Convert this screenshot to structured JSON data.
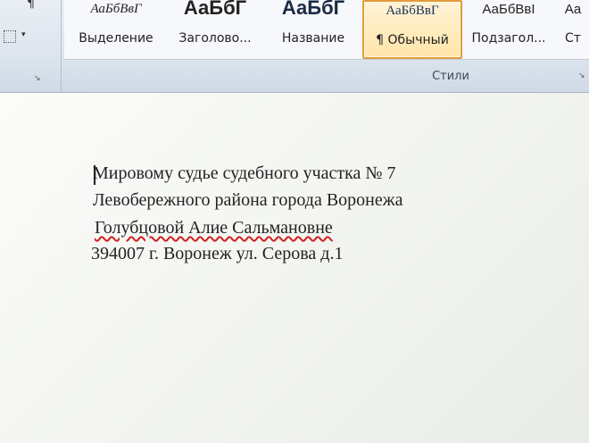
{
  "ribbon": {
    "left_tools": {
      "paragraph_mark": "¶",
      "borders_icon": "borders-icon",
      "dropdown_arrow": "▾",
      "launcher": "↘"
    },
    "styles_group": {
      "label": "Стили",
      "launcher": "↘",
      "items": [
        {
          "sample": "АаБбВвГ",
          "label": "Выделение"
        },
        {
          "sample": "АаБбГ",
          "label": "Заголово..."
        },
        {
          "sample": "АаБбГ",
          "label": "Название"
        },
        {
          "sample": "АаБбВвГ",
          "label": "¶ Обычный",
          "selected": true
        },
        {
          "sample": "АаБбВвІ",
          "label": "Подзагол..."
        },
        {
          "sample": "Аа",
          "label": "Ст"
        }
      ]
    }
  },
  "document": {
    "lines": [
      "Мировому судье судебного участка № 7",
      "Левобережного  района города Воронежа",
      "Голубцовой Алие Сальмановне",
      "394007 г. Воронеж ул. Серова д.1"
    ]
  },
  "colors": {
    "selected_border": "#e49b3b",
    "spell_underline": "#d02020"
  }
}
